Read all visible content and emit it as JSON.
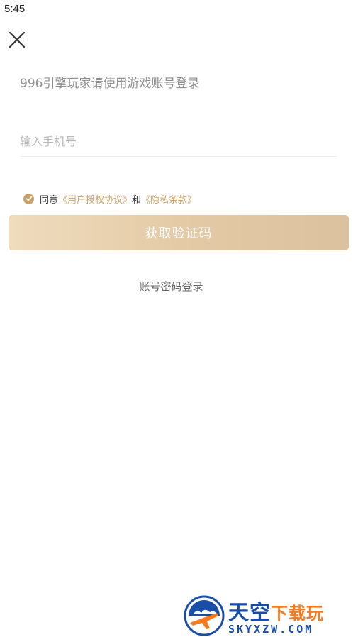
{
  "status_bar": {
    "time": "5:45"
  },
  "login": {
    "hint": "996引擎玩家请使用游戏账号登录",
    "phone_placeholder": "输入手机号",
    "agree_prefix": "同意",
    "terms_link": "《用户授权协议》",
    "conjunction": "和",
    "privacy_link": "《隐私条款》",
    "get_code_button": "获取验证码",
    "account_login_link": "账号密码登录",
    "agreement_checked": true
  },
  "watermark": {
    "brand_main": "天空",
    "brand_accent": "下载玩",
    "site": "SKYXZW.COM"
  },
  "colors": {
    "accent": "#c9a36b",
    "button_start": "#efdcbd",
    "button_end": "#dcc19f",
    "watermark_blue": "#1a4da8",
    "watermark_orange": "#f47b20"
  },
  "icons": {
    "close": "close-icon",
    "check": "check-icon",
    "watermark_logo": "plane-logo-icon"
  }
}
